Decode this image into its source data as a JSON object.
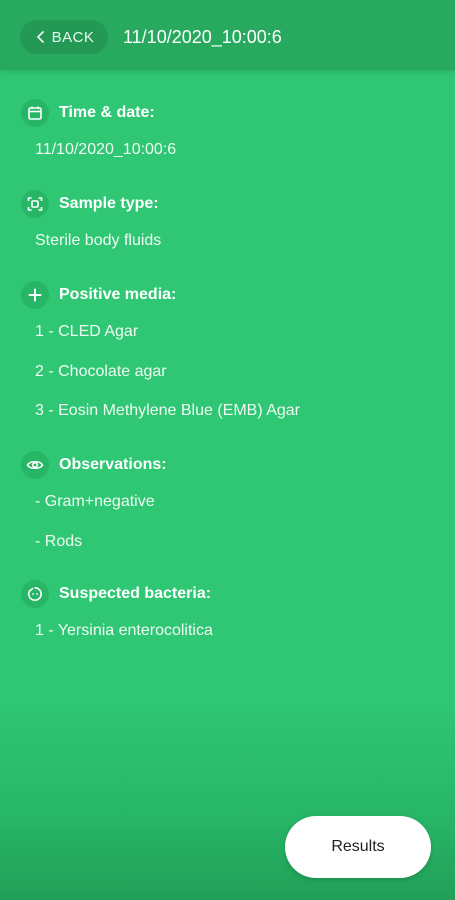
{
  "header": {
    "back_label": "BACK",
    "title": "11/10/2020_10:00:6"
  },
  "sections": {
    "time": {
      "icon": "calendar-icon",
      "title": "Time & date:",
      "lines": [
        "11/10/2020_10:00:6"
      ]
    },
    "sample": {
      "icon": "scan-frame-icon",
      "title": "Sample type:",
      "lines": [
        "Sterile body fluids"
      ]
    },
    "media": {
      "icon": "plus-icon",
      "title": "Positive media:",
      "lines": [
        "1 - CLED Agar",
        "2 - Chocolate agar",
        "3 - Eosin Methylene Blue (EMB) Agar"
      ]
    },
    "observations": {
      "icon": "eye-icon",
      "title": "Observations:",
      "lines": [
        "- Gram+negative",
        "- Rods"
      ]
    },
    "bacteria": {
      "icon": "bacteria-face-icon",
      "title": "Suspected bacteria:",
      "lines": [
        "1 - Yersinia enterocolitica"
      ]
    }
  },
  "footer": {
    "results_label": "Results"
  },
  "colors": {
    "background": "#2fc774",
    "header": "#27a95e",
    "button": "#ffffff"
  }
}
